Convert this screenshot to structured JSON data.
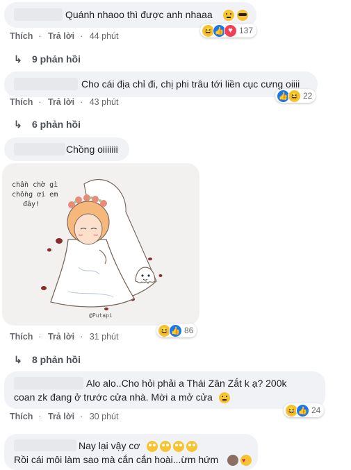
{
  "meta": {
    "like": "Thích",
    "reply": "Trả lời",
    "dot": "·"
  },
  "colors": {
    "bubble": "#f0f2f5",
    "meta_text": "#65676b",
    "like": "#1877f2",
    "haha": "#f7c32e",
    "love": "#f33e58"
  },
  "comments": [
    {
      "text": "Quánh nhaoo thì được anh nhaaa",
      "time": "44 phút",
      "reactions": "137",
      "replies": "9 phản hồi"
    },
    {
      "text": "Cho cái địa chỉ đi, chị phi trâu tới liền cục cưng oiiii",
      "time": "43 phút",
      "reactions": "22",
      "replies": "6 phản hồi"
    },
    {
      "text": "Chồng oiiiiiii",
      "time": "31 phút",
      "reactions": "86",
      "replies": "8 phản hồi",
      "sticker": {
        "caption_line1": "chần chờ gì",
        "caption_line2": "chồng ơi em",
        "caption_line3": "đây!",
        "signature": "@Putapi"
      }
    },
    {
      "text_line1": "Alo alo..Cho hỏi phải a Thái Zăn Zắt k ạ? 200k",
      "text_line2": "coan zk đang ở trước cửa nhà. Mời a mở cửa",
      "time": "30 phút",
      "reactions": "24"
    },
    {
      "text_line1": "Nay lại vậy cơ",
      "text_line2": "Rồi cái môi làm sao mà cắn cắn hoài...ừm hứm"
    }
  ]
}
